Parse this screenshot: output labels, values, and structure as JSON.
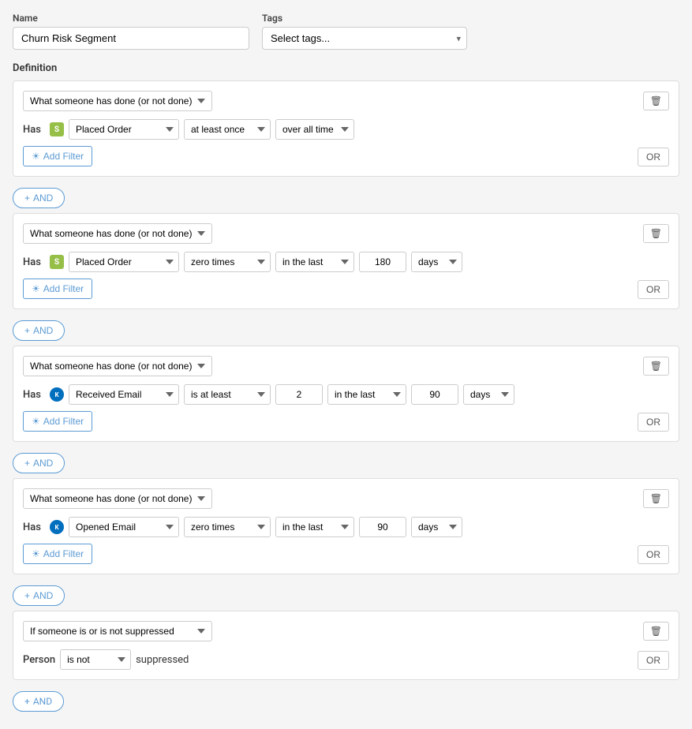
{
  "header": {
    "name_label": "Name",
    "name_value": "Churn Risk Segment",
    "tags_label": "Tags",
    "tags_placeholder": "Select tags..."
  },
  "definition": {
    "label": "Definition"
  },
  "blocks": [
    {
      "id": 1,
      "type_label": "What someone has done (or not done)",
      "has_label": "Has",
      "icon_type": "shopify",
      "event_label": "Placed Order",
      "frequency_label": "at least once",
      "time_label": "over all time",
      "number_value": null,
      "days_value": null,
      "add_filter_label": "Add Filter",
      "or_label": "OR",
      "show_number": false,
      "show_days": false
    },
    {
      "id": 2,
      "type_label": "What someone has done (or not done)",
      "has_label": "Has",
      "icon_type": "shopify",
      "event_label": "Placed Order",
      "frequency_label": "zero times",
      "time_label": "in the last",
      "number_value": "180",
      "days_value": "days",
      "add_filter_label": "Add Filter",
      "or_label": "OR",
      "show_number": true,
      "show_days": true
    },
    {
      "id": 3,
      "type_label": "What someone has done (or not done)",
      "has_label": "Has",
      "icon_type": "klaviyo",
      "event_label": "Received Email",
      "frequency_label": "is at least",
      "time_label": "in the last",
      "number_value": "2",
      "days_value": "days",
      "days_number": "90",
      "add_filter_label": "Add Filter",
      "or_label": "OR",
      "show_number": true,
      "show_days": true,
      "show_freq_number": true
    },
    {
      "id": 4,
      "type_label": "What someone has done (or not done)",
      "has_label": "Has",
      "icon_type": "klaviyo",
      "event_label": "Opened Email",
      "frequency_label": "zero times",
      "time_label": "in the last",
      "number_value": "90",
      "days_value": "days",
      "add_filter_label": "Add Filter",
      "or_label": "OR",
      "show_number": true,
      "show_days": true
    },
    {
      "id": 5,
      "type_label": "If someone is or is not suppressed",
      "has_label": "Person",
      "icon_type": null,
      "event_label": null,
      "frequency_label": "is not",
      "time_label": null,
      "suppressed_text": "suppressed",
      "add_filter_label": null,
      "or_label": "OR",
      "show_number": false,
      "show_days": false,
      "is_suppressed": true
    }
  ],
  "and_button_label": "+ AND",
  "icons": {
    "delete": "🗑",
    "filter": "▾",
    "plus": "+"
  }
}
